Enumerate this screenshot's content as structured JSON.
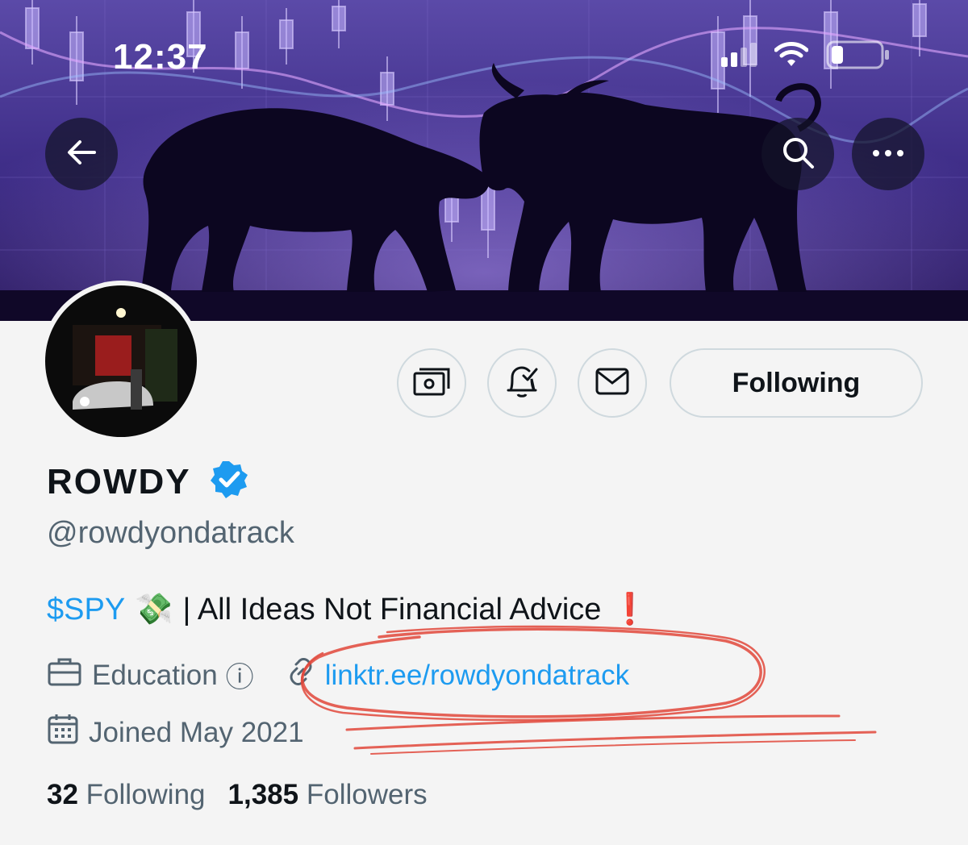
{
  "status_bar": {
    "time": "12:37"
  },
  "profile": {
    "display_name": "ROWDY",
    "handle": "@rowdyondatrack",
    "bio": {
      "cashtag": "$SPY",
      "emoji": "💸",
      "text": "| All Ideas Not Financial Advice",
      "mark": "❗"
    },
    "category": "Education",
    "category_info": "ⓘ",
    "website": "linktr.ee/rowdyondatrack",
    "joined": "Joined May 2021",
    "following_count": "32",
    "following_label": "Following",
    "followers_count": "1,385",
    "followers_label": "Followers"
  },
  "actions": {
    "following_button": "Following"
  },
  "colors": {
    "accent": "#1d9bf0",
    "banner_bg": "#3a2a7a",
    "annotation": "#e0463a"
  }
}
